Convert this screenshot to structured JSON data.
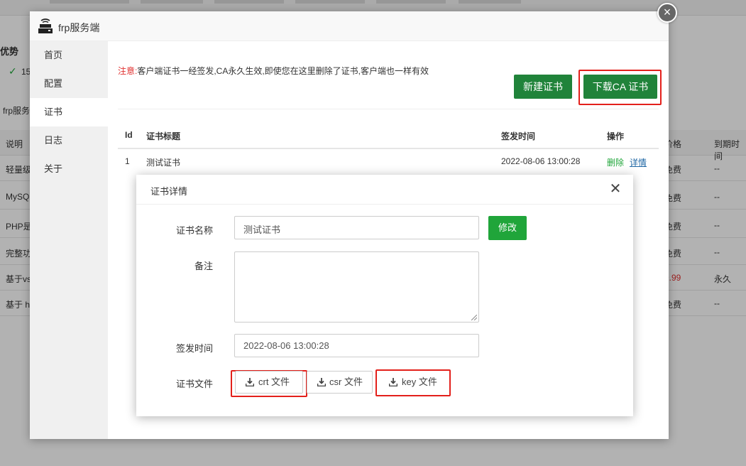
{
  "background": {
    "section_title": "优势",
    "status_text": "15",
    "subtitle": "frp服务",
    "table_header_left": "说明",
    "table_header_price": "价格",
    "table_header_expire": "到期时间",
    "rows": [
      {
        "desc": "轻量级",
        "price": "免费",
        "expire": "--"
      },
      {
        "desc": "MySQ",
        "price": "免费",
        "expire": "--"
      },
      {
        "desc": "PHP是",
        "price": "免费",
        "expire": "--"
      },
      {
        "desc": "完整功",
        "price": "免费",
        "expire": "--"
      },
      {
        "desc": "基于vs",
        "price": "9.99",
        "expire": "永久"
      },
      {
        "desc": "基于 h",
        "price": "免费",
        "expire": "--"
      }
    ]
  },
  "window": {
    "title": "frp服务端",
    "sidebar": [
      {
        "label": "首页"
      },
      {
        "label": "配置"
      },
      {
        "label": "证书"
      },
      {
        "label": "日志"
      },
      {
        "label": "关于"
      }
    ],
    "notice_prefix": "注意:",
    "notice_text": "客户端证书一经签发,CA永久生效,即使您在这里删除了证书,客户端也一样有效",
    "new_cert_label": "新建证书",
    "download_ca_label": "下载CA 证书",
    "table": {
      "headers": {
        "id": "Id",
        "title": "证书标题",
        "time": "签发时间",
        "ops": "操作"
      },
      "rows": [
        {
          "id": "1",
          "title": "测试证书",
          "time": "2022-08-06 13:00:28",
          "delete": "删除",
          "detail": "详情"
        }
      ]
    }
  },
  "dialog": {
    "title": "证书详情",
    "name_label": "证书名称",
    "name_value": "测试证书",
    "edit_label": "修改",
    "remark_label": "备注",
    "remark_value": "",
    "time_label": "签发时间",
    "time_value": "2022-08-06 13:00:28",
    "files_label": "证书文件",
    "files": [
      {
        "label": "crt 文件"
      },
      {
        "label": "csr 文件"
      },
      {
        "label": "key 文件"
      }
    ]
  },
  "colors": {
    "accent_green": "#20a53a",
    "dark_green": "#20833a",
    "highlight_red": "#e3201b",
    "warn_red": "#e0302f",
    "link_blue": "#2168a5"
  }
}
